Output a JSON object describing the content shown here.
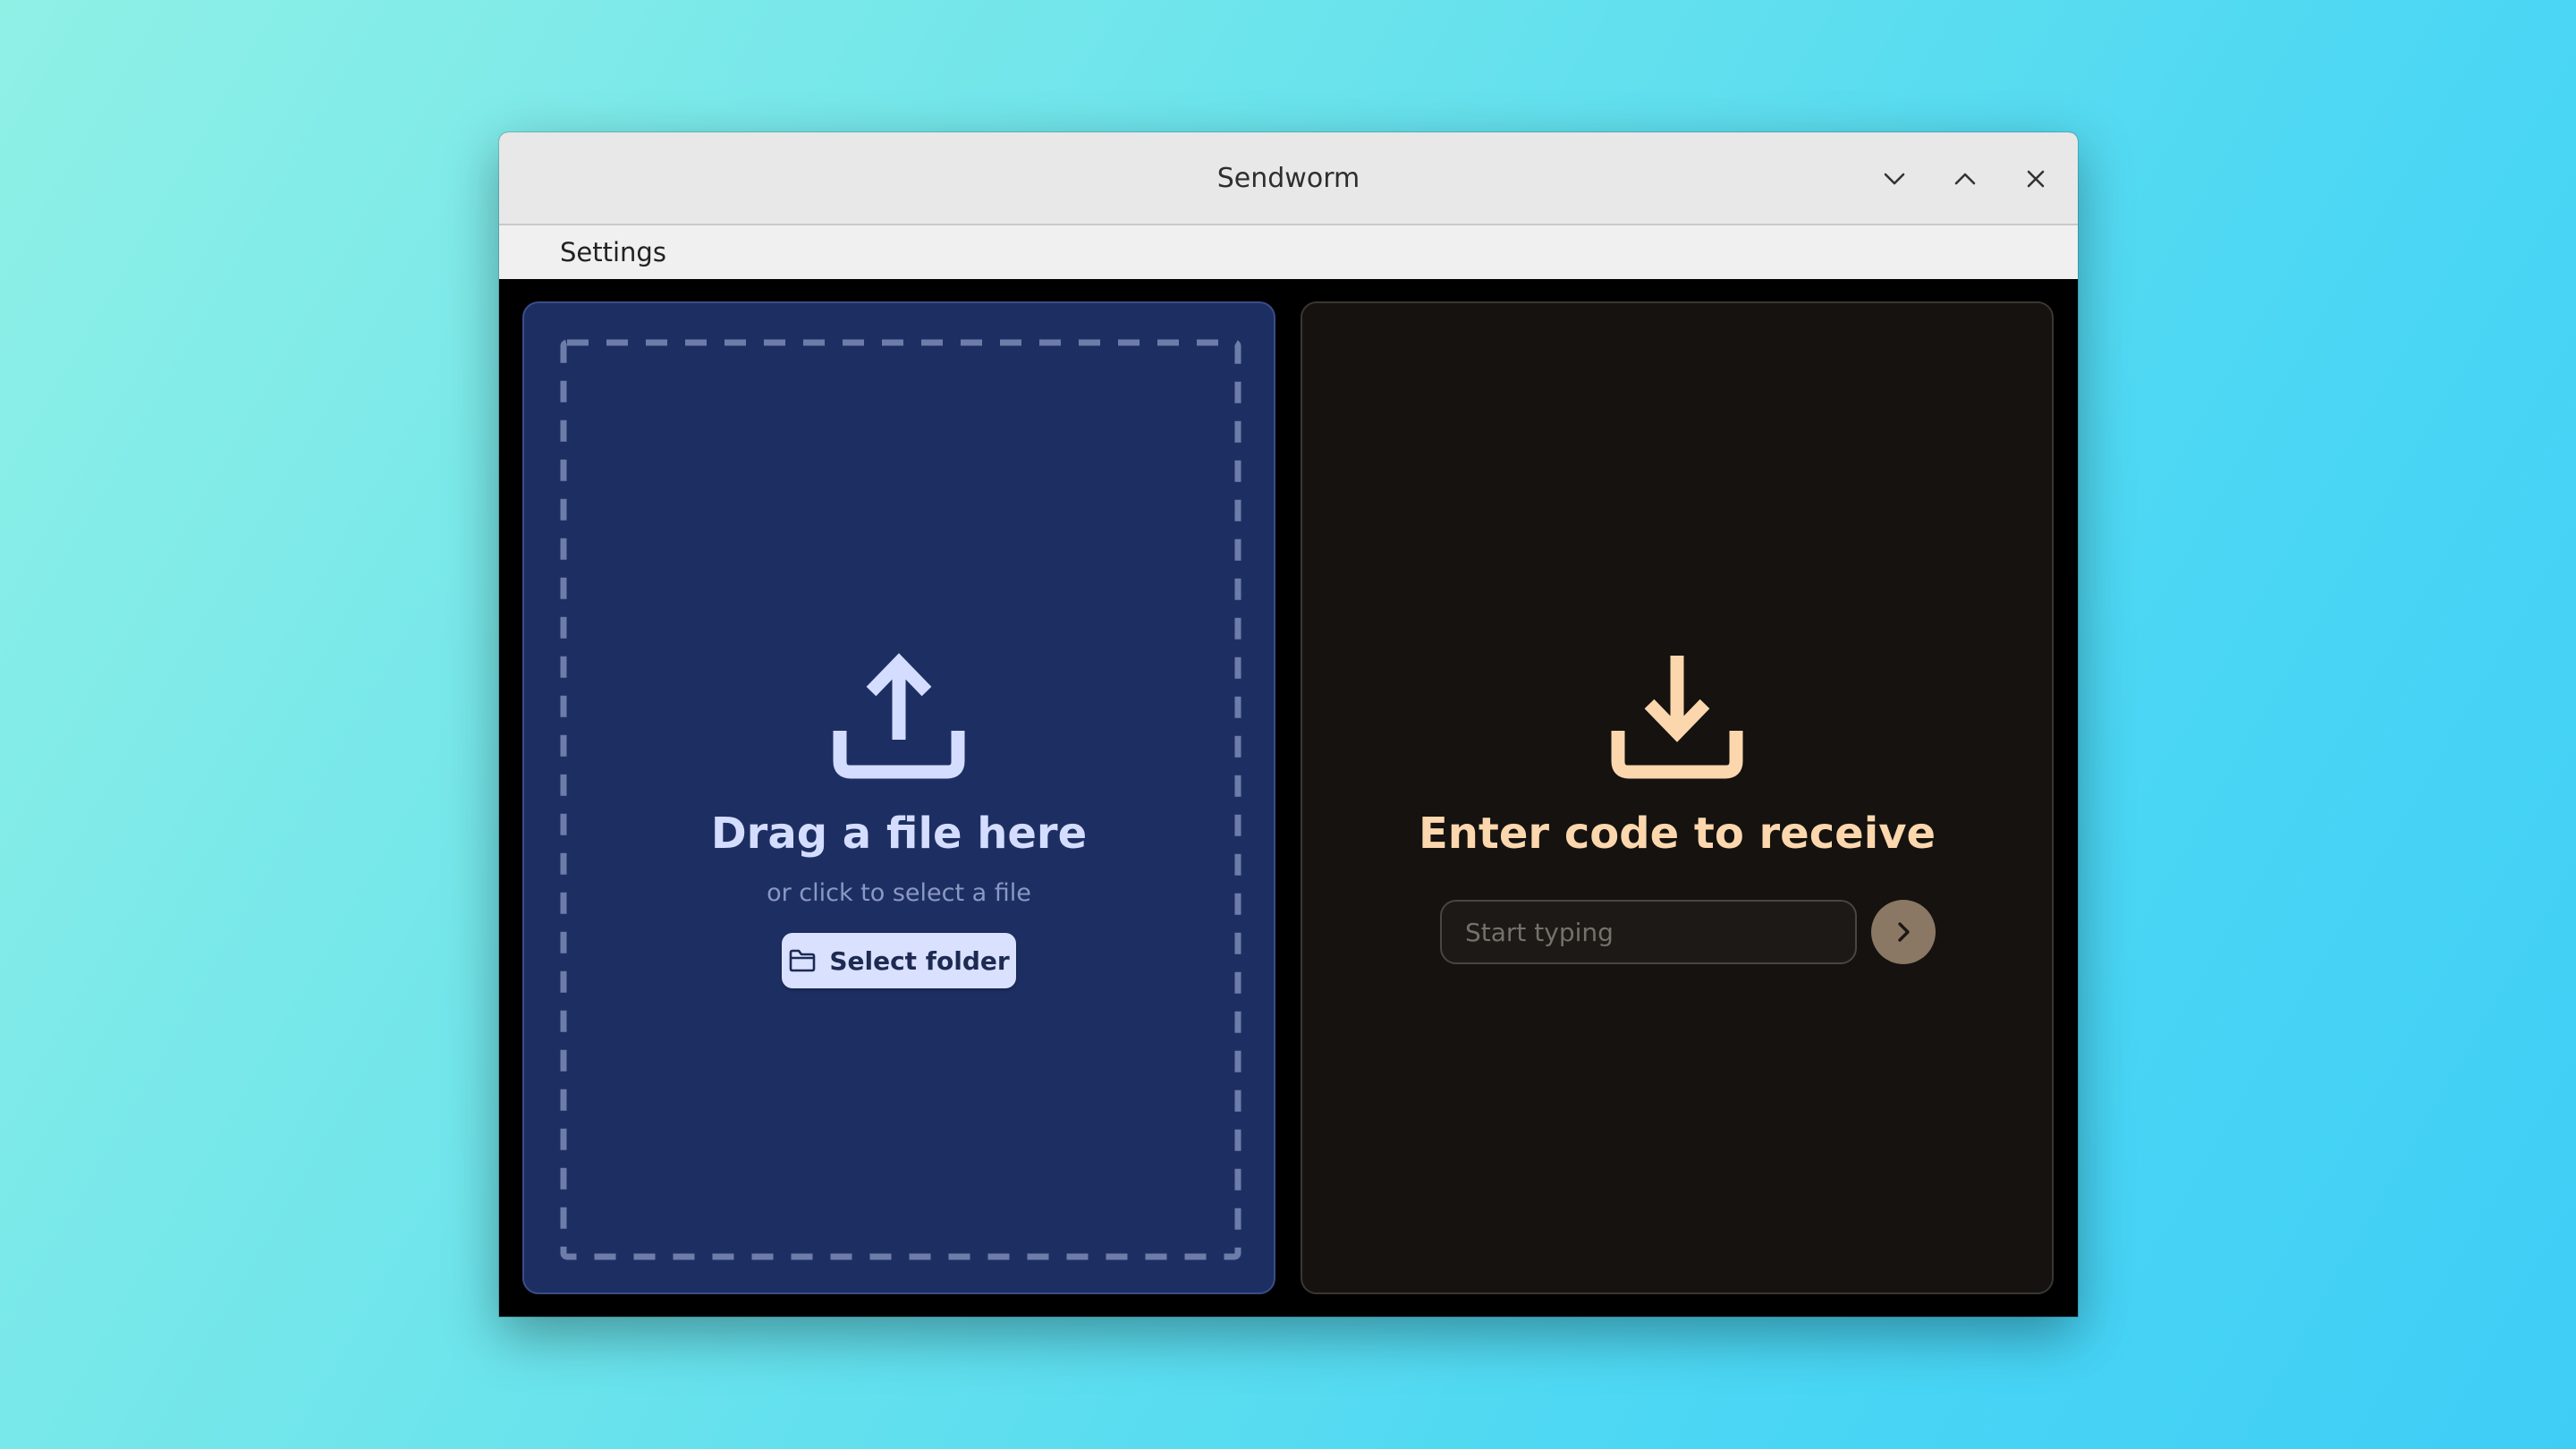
{
  "window": {
    "title": "Sendworm"
  },
  "window_controls": {
    "minimize_icon": "chevron-down-icon",
    "maximize_icon": "chevron-up-icon",
    "close_icon": "close-icon"
  },
  "menu": {
    "items": [
      {
        "label": "Settings"
      }
    ]
  },
  "send_panel": {
    "icon": "upload-icon",
    "heading": "Drag a file here",
    "subtext": "or click to select a file",
    "folder_button": {
      "icon": "folder-icon",
      "label": "Select folder"
    }
  },
  "receive_panel": {
    "icon": "download-icon",
    "heading": "Enter code to receive",
    "input": {
      "value": "",
      "placeholder": "Start typing"
    },
    "submit_icon": "chevron-right-icon"
  },
  "colors": {
    "send_panel_bg": "#1d2f62",
    "send_accent": "#d4ddff",
    "receive_panel_bg": "#15120f",
    "receive_accent": "#fcd7ad",
    "submit_button_bg": "#8b7864"
  }
}
